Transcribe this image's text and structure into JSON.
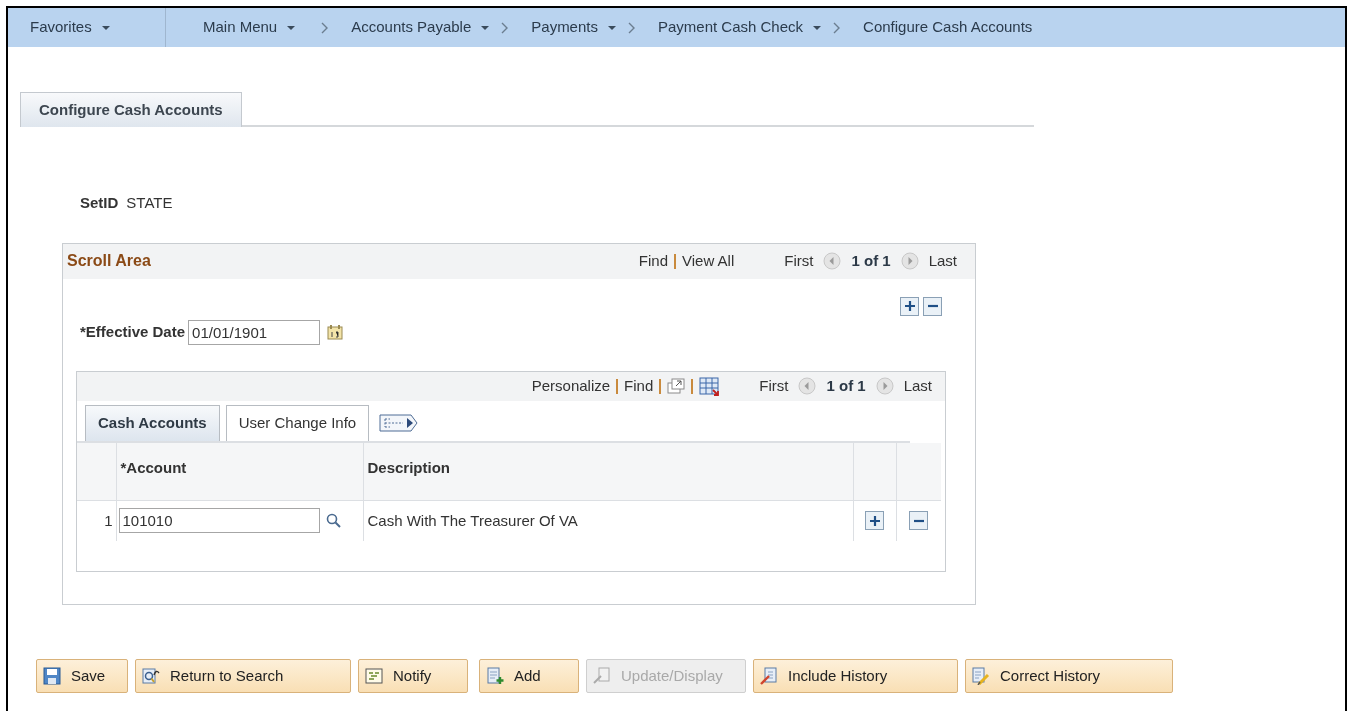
{
  "nav": [
    {
      "label": "Favorites",
      "dropdown": true,
      "kind": "menu"
    },
    {
      "label": "Main Menu",
      "dropdown": true,
      "kind": "menu"
    },
    {
      "label": "Accounts Payable",
      "dropdown": true,
      "kind": "crumb"
    },
    {
      "label": "Payments",
      "dropdown": true,
      "kind": "crumb"
    },
    {
      "label": "Payment Cash Check",
      "dropdown": true,
      "kind": "crumb"
    },
    {
      "label": "Configure Cash Accounts",
      "dropdown": false,
      "kind": "crumb"
    }
  ],
  "page_tabs": [
    {
      "label": "Configure Cash Accounts",
      "selected": true
    }
  ],
  "setid": {
    "label": "SetID",
    "value": "STATE"
  },
  "scroll_area": {
    "title": "Scroll Area",
    "links": [
      "Find",
      "View All"
    ],
    "pager": {
      "first": "First",
      "count": "1 of 1",
      "last": "Last"
    },
    "effective_date": {
      "label": "*Effective Date",
      "value": "01/01/1901"
    },
    "grid": {
      "links": [
        "Personalize",
        "Find"
      ],
      "pager": {
        "first": "First",
        "count": "1 of 1",
        "last": "Last"
      },
      "tabs": [
        {
          "label": "Cash Accounts",
          "selected": true
        },
        {
          "label": "User Change Info",
          "selected": false
        }
      ],
      "columns": [
        "*Account",
        "Description"
      ],
      "rows": [
        {
          "number": "1",
          "account": "101010",
          "description": "Cash With The Treasurer Of VA"
        }
      ]
    }
  },
  "buttons": [
    {
      "label": "Save",
      "kind": "save",
      "disabled": false
    },
    {
      "label": "Return to Search",
      "kind": "return",
      "disabled": false
    },
    {
      "label": "Notify",
      "kind": "notify",
      "disabled": false
    },
    {
      "label": "Add",
      "kind": "add",
      "disabled": false
    },
    {
      "label": "Update/Display",
      "kind": "update",
      "disabled": true
    },
    {
      "label": "Include History",
      "kind": "include",
      "disabled": false
    },
    {
      "label": "Correct History",
      "kind": "correct",
      "disabled": false
    }
  ]
}
